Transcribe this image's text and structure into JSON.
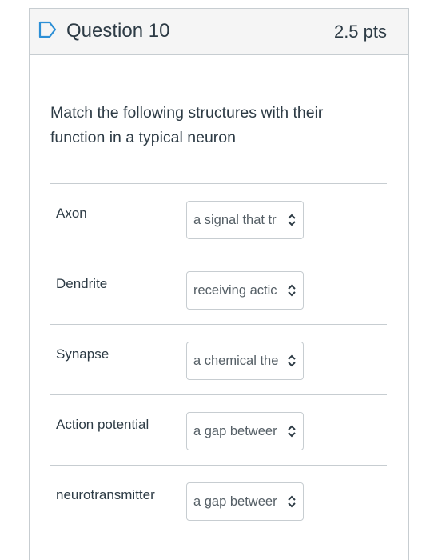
{
  "question": {
    "title": "Question 10",
    "points": "2.5 pts",
    "prompt": "Match the following structures with their function in a typical neuron"
  },
  "colors": {
    "accent": "#2c8fd6",
    "border": "#c7cdd1",
    "header_bg": "#f5f5f5",
    "text": "#2d3b45"
  },
  "rows": [
    {
      "label": "Axon",
      "selected": "a signal that tr"
    },
    {
      "label": "Dendrite",
      "selected": "receiving actic"
    },
    {
      "label": "Synapse",
      "selected": "a chemical the"
    },
    {
      "label": "Action potential",
      "selected": "a gap betweer"
    },
    {
      "label": "neurotransmitter",
      "selected": "a gap betweer"
    }
  ],
  "icons": {
    "flag": "bookmark-flag-icon",
    "select": "chevron-up-down-icon"
  }
}
